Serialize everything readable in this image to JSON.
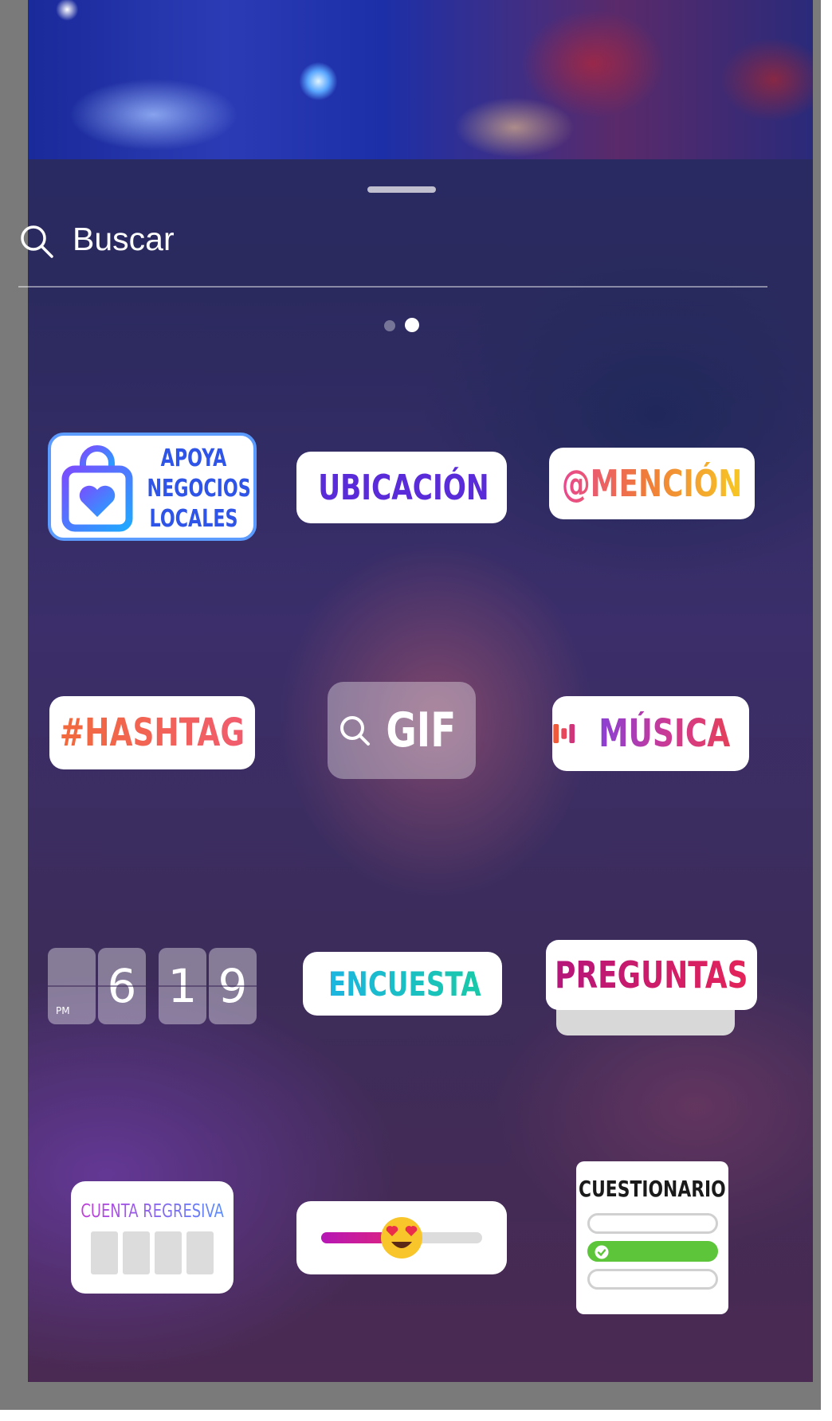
{
  "search": {
    "label": "Buscar"
  },
  "stickers": {
    "apoya": {
      "lines": [
        "APOYA",
        "NEGOCIOS",
        "LOCALES"
      ]
    },
    "ubicacion": {
      "label": "UBICACIÓN"
    },
    "mencion": {
      "label": "@MENCIÓN"
    },
    "hashtag": {
      "label": "#HASHTAG"
    },
    "gif": {
      "label": "GIF"
    },
    "musica": {
      "label": "MÚSICA"
    },
    "clock": {
      "meridiem": "PM",
      "hour": "6",
      "minute_tens": "1",
      "minute_ones": "9"
    },
    "encuesta": {
      "label": "ENCUESTA"
    },
    "preguntas": {
      "label": "PREGUNTAS"
    },
    "cuenta_regresiva": {
      "label": "CUENTA REGRESIVA"
    },
    "cuestionario": {
      "label": "CUESTIONARIO"
    }
  },
  "pagination": {
    "pages": 2,
    "current": 2
  },
  "icons": [
    "search-icon",
    "shopping-bag-heart-icon",
    "location-pin-icon",
    "music-bars-icon",
    "poll-lines-icon",
    "heart-eyes-emoji-icon",
    "check-icon"
  ],
  "colors": {
    "apoya_blue": "#2f54e8",
    "ubicacion_purple": "#5a2bd8",
    "quiz_correct_green": "#5cc53a"
  }
}
